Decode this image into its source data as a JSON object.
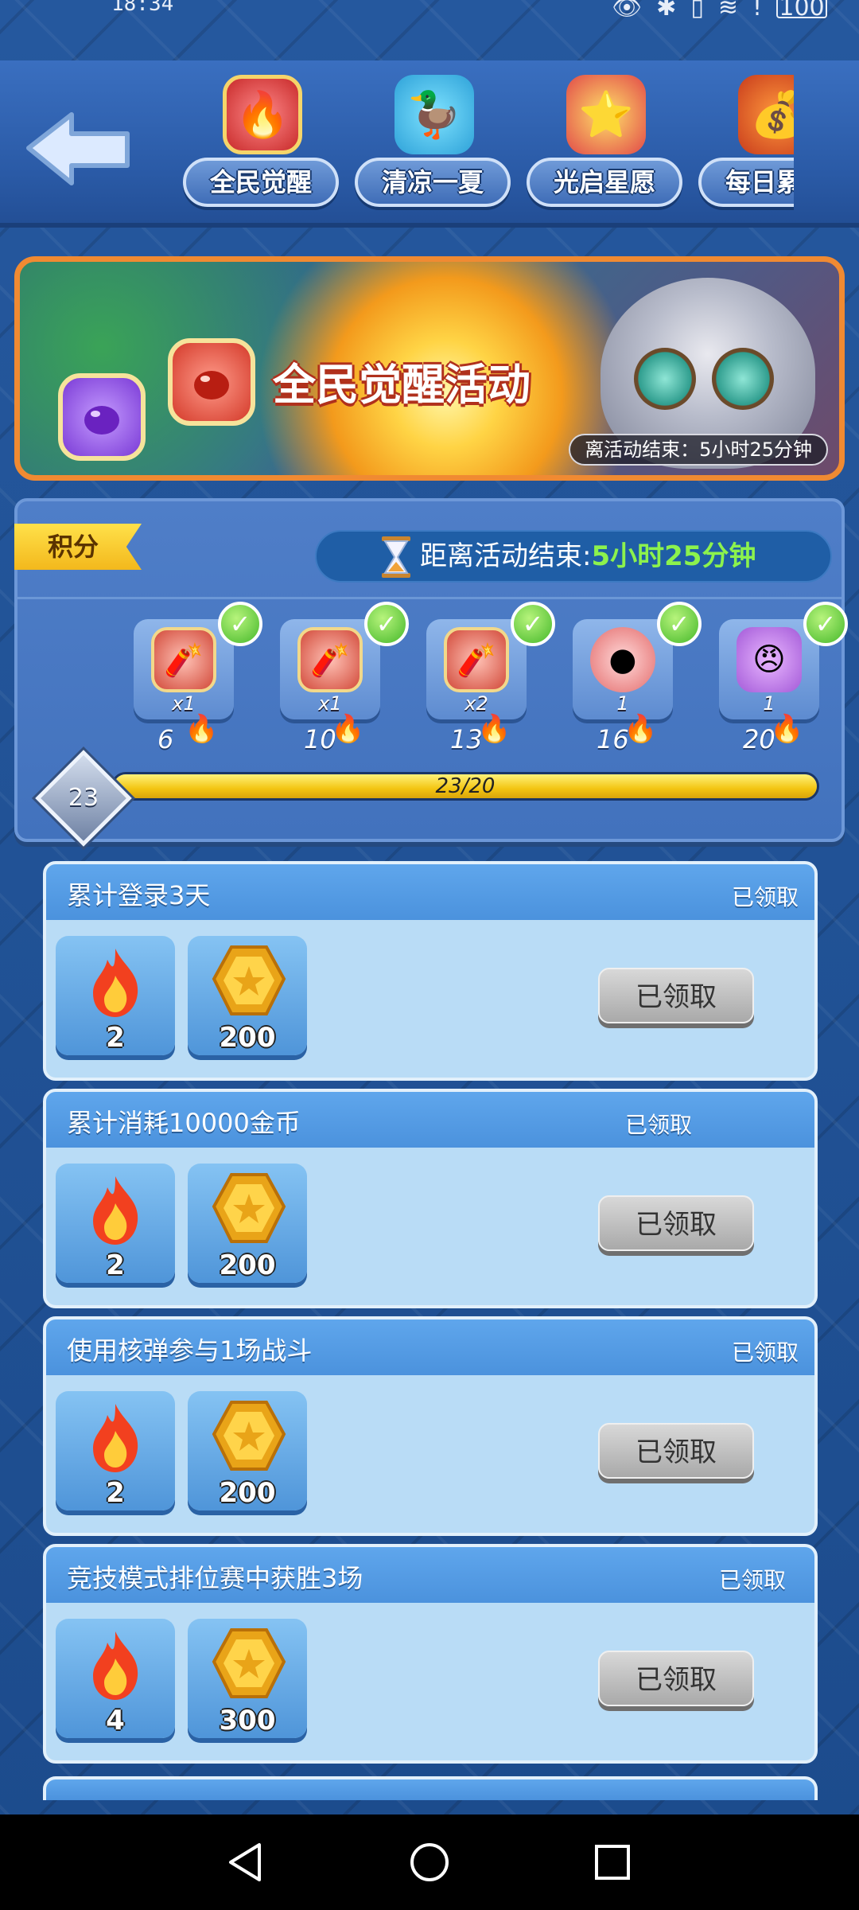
{
  "status_bar": {
    "time": "18:34",
    "battery": "100"
  },
  "header": {
    "tabs": [
      {
        "label": "全民觉醒",
        "icon": "awakening-icon"
      },
      {
        "label": "清凉一夏",
        "icon": "duck-icon"
      },
      {
        "label": "光启星愿",
        "icon": "star-icon"
      },
      {
        "label": "每日累消",
        "icon": "treasure-bag-icon"
      }
    ]
  },
  "banner": {
    "title": "全民觉醒活动",
    "timer": "离活动结束：5小时25分钟"
  },
  "score": {
    "tag": "积分",
    "countdown_prefix": "距离活动结束:",
    "countdown_value": "5小时25分钟",
    "level": "23",
    "progress_text": "23/20",
    "progress_fraction": 1.0,
    "milestones": [
      {
        "qty": "x1",
        "points": "6",
        "claimed": true
      },
      {
        "qty": "x1",
        "points": "10",
        "claimed": true
      },
      {
        "qty": "x2",
        "points": "13",
        "claimed": true
      },
      {
        "qty": "1",
        "points": "16",
        "claimed": true
      },
      {
        "qty": "1",
        "points": "20",
        "claimed": true
      }
    ]
  },
  "tasks": [
    {
      "title": "累计登录3天",
      "status": "已领取",
      "rewards": [
        "2",
        "200"
      ],
      "button": "已领取"
    },
    {
      "title": "累计消耗10000金币",
      "status": "已领取",
      "rewards": [
        "2",
        "200"
      ],
      "button": "已领取"
    },
    {
      "title": "使用核弹参与1场战斗",
      "status": "已领取",
      "rewards": [
        "2",
        "200"
      ],
      "button": "已领取"
    },
    {
      "title": "竞技模式排位赛中获胜3场",
      "status": "已领取",
      "rewards": [
        "4",
        "300"
      ],
      "button": "已领取"
    }
  ],
  "colors": {
    "accent_green": "#8cf24d",
    "banner_border": "#f08a32",
    "progress_yellow": "#f3c512"
  }
}
